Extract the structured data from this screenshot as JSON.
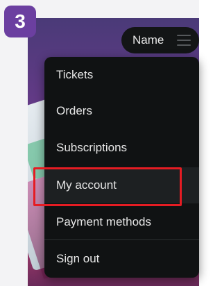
{
  "step_badge": "3",
  "header": {
    "user_name": "Name",
    "menu_icon": "hamburger-icon"
  },
  "menu": {
    "items": [
      {
        "label": "Tickets"
      },
      {
        "label": "Orders"
      },
      {
        "label": "Subscriptions"
      },
      {
        "label": "My account",
        "highlighted": true
      },
      {
        "label": "Payment methods"
      },
      {
        "label": "Sign out"
      }
    ]
  },
  "colors": {
    "badge": "#6b3fa0",
    "menu_bg": "#101213",
    "highlight": "#e51c23"
  }
}
